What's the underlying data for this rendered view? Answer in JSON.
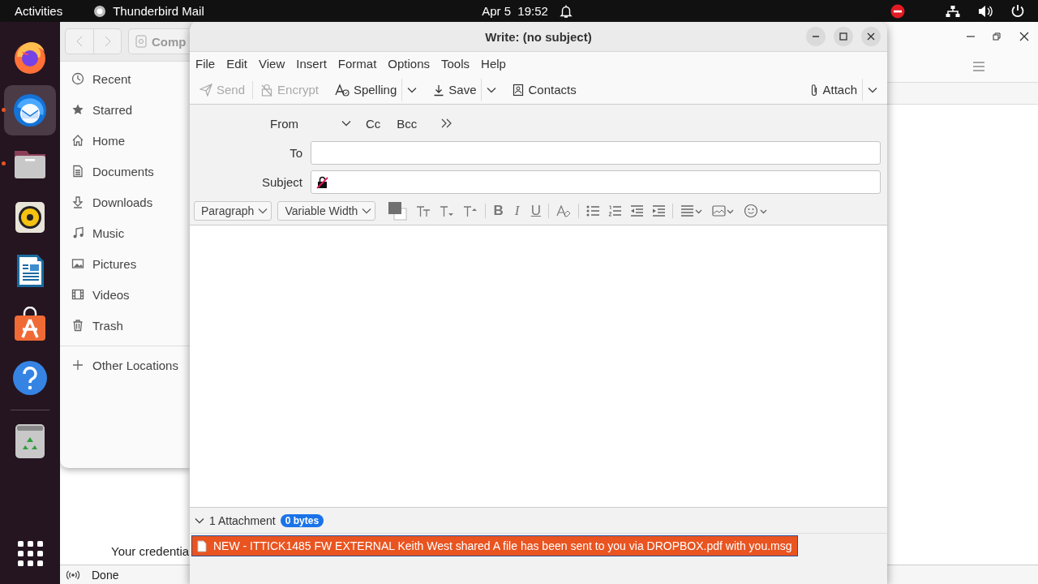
{
  "top_bar": {
    "activities": "Activities",
    "app": "Thunderbird Mail",
    "clock": "Apr 5  19:52"
  },
  "dock": {
    "apps": [
      {
        "kind": "firefox",
        "selected": false,
        "running": false
      },
      {
        "kind": "thunderbird",
        "selected": true,
        "running": true
      },
      {
        "kind": "files",
        "selected": false,
        "running": true
      },
      {
        "kind": "rhythmbox",
        "selected": false,
        "running": false
      },
      {
        "kind": "writer",
        "selected": false,
        "running": false
      },
      {
        "kind": "appcenter",
        "selected": false,
        "running": false
      },
      {
        "kind": "help",
        "selected": false,
        "running": false
      },
      {
        "kind": "trash",
        "selected": false,
        "running": false
      }
    ]
  },
  "mail_window": {
    "message_text": "Your credentia",
    "status": "Done"
  },
  "files_window": {
    "location": "Comp",
    "places": [
      {
        "kind": "recent",
        "label": "Recent"
      },
      {
        "kind": "starred",
        "label": "Starred"
      },
      {
        "kind": "home",
        "label": "Home"
      },
      {
        "kind": "documents",
        "label": "Documents"
      },
      {
        "kind": "downloads",
        "label": "Downloads"
      },
      {
        "kind": "music",
        "label": "Music"
      },
      {
        "kind": "pictures",
        "label": "Pictures"
      },
      {
        "kind": "videos",
        "label": "Videos"
      },
      {
        "kind": "trash",
        "label": "Trash"
      }
    ],
    "other": "Other Locations"
  },
  "compose": {
    "title": "Write: (no subject)",
    "menu": [
      "File",
      "Edit",
      "View",
      "Insert",
      "Format",
      "Options",
      "Tools",
      "Help"
    ],
    "toolbar": [
      {
        "kind": "send",
        "label": "Send",
        "disabled": true,
        "dropdown": false
      },
      {
        "kind": "encrypt",
        "label": "Encrypt",
        "disabled": true,
        "dropdown": false
      },
      {
        "kind": "spelling",
        "label": "Spelling",
        "disabled": false,
        "dropdown": true
      },
      {
        "kind": "save",
        "label": "Save",
        "disabled": false,
        "dropdown": true
      },
      {
        "kind": "contacts",
        "label": "Contacts",
        "disabled": false,
        "dropdown": false
      }
    ],
    "attach": {
      "label": "Attach",
      "dropdown": true
    },
    "from_label": "From",
    "cc": "Cc",
    "bcc": "Bcc",
    "to_label": "To",
    "subject_label": "Subject",
    "paragraph": "Paragraph",
    "font": "Variable Width",
    "format_buttons": [
      {
        "kind": "color"
      },
      {
        "kind": "reset-size"
      },
      {
        "kind": "smaller"
      },
      {
        "kind": "larger"
      },
      {
        "kind": "sep"
      },
      {
        "kind": "bold",
        "glyph": "B"
      },
      {
        "kind": "italic",
        "glyph": "I"
      },
      {
        "kind": "underline",
        "glyph": "U"
      },
      {
        "kind": "sep"
      },
      {
        "kind": "clear"
      },
      {
        "kind": "sep"
      },
      {
        "kind": "bullets"
      },
      {
        "kind": "numbers"
      },
      {
        "kind": "outdent"
      },
      {
        "kind": "indent"
      },
      {
        "kind": "sep"
      },
      {
        "kind": "align"
      },
      {
        "kind": "image"
      },
      {
        "kind": "emoji"
      }
    ],
    "attachment_count": "1 Attachment",
    "attachment_size": "0 bytes",
    "attachments": [
      {
        "name": "NEW - ITTICK1485 FW EXTERNAL Keith West shared A file has been sent to you via DROPBOX.pdf with you.msg",
        "selected": true
      }
    ]
  }
}
